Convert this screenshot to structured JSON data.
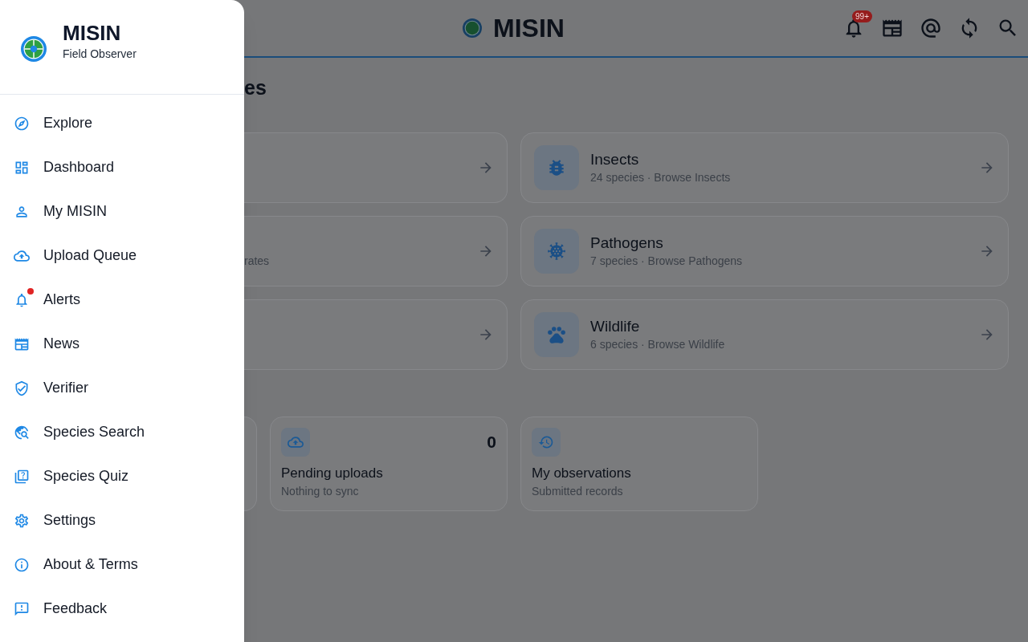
{
  "drawer": {
    "title": "MISIN",
    "subtitle": "Field Observer",
    "items": [
      {
        "label": "Explore",
        "alert": false
      },
      {
        "label": "Dashboard",
        "alert": false
      },
      {
        "label": "My MISIN",
        "alert": false
      },
      {
        "label": "Upload Queue",
        "alert": false
      },
      {
        "label": "Alerts",
        "alert": true
      },
      {
        "label": "News",
        "alert": false
      },
      {
        "label": "Verifier",
        "alert": false
      },
      {
        "label": "Species Search",
        "alert": false
      },
      {
        "label": "Species Quiz",
        "alert": false
      },
      {
        "label": "Settings",
        "alert": false
      },
      {
        "label": "About & Terms",
        "alert": false
      },
      {
        "label": "Feedback",
        "alert": false
      }
    ]
  },
  "top_bar": {
    "title": "MISIN",
    "notification_badge": "99+"
  },
  "content": {
    "heading_fragment": "es",
    "category_cards": [
      {
        "kind": "cut"
      },
      {
        "kind": "full",
        "title": "Insects",
        "subtitle": "24 species · Browse Insects"
      },
      {
        "kind": "cut",
        "subtitle": "rates"
      },
      {
        "kind": "full",
        "title": "Pathogens",
        "subtitle": "7 species · Browse Pathogens"
      },
      {
        "kind": "cut"
      },
      {
        "kind": "full",
        "title": "Wildlife",
        "subtitle": "6 species · Browse Wildlife"
      }
    ],
    "stat_cards": [
      {
        "kind": "cut"
      },
      {
        "kind": "full",
        "title": "Pending uploads",
        "subtitle": "Nothing to sync",
        "count": "0"
      },
      {
        "kind": "full",
        "title": "My observations",
        "subtitle": "Submitted records"
      }
    ]
  }
}
